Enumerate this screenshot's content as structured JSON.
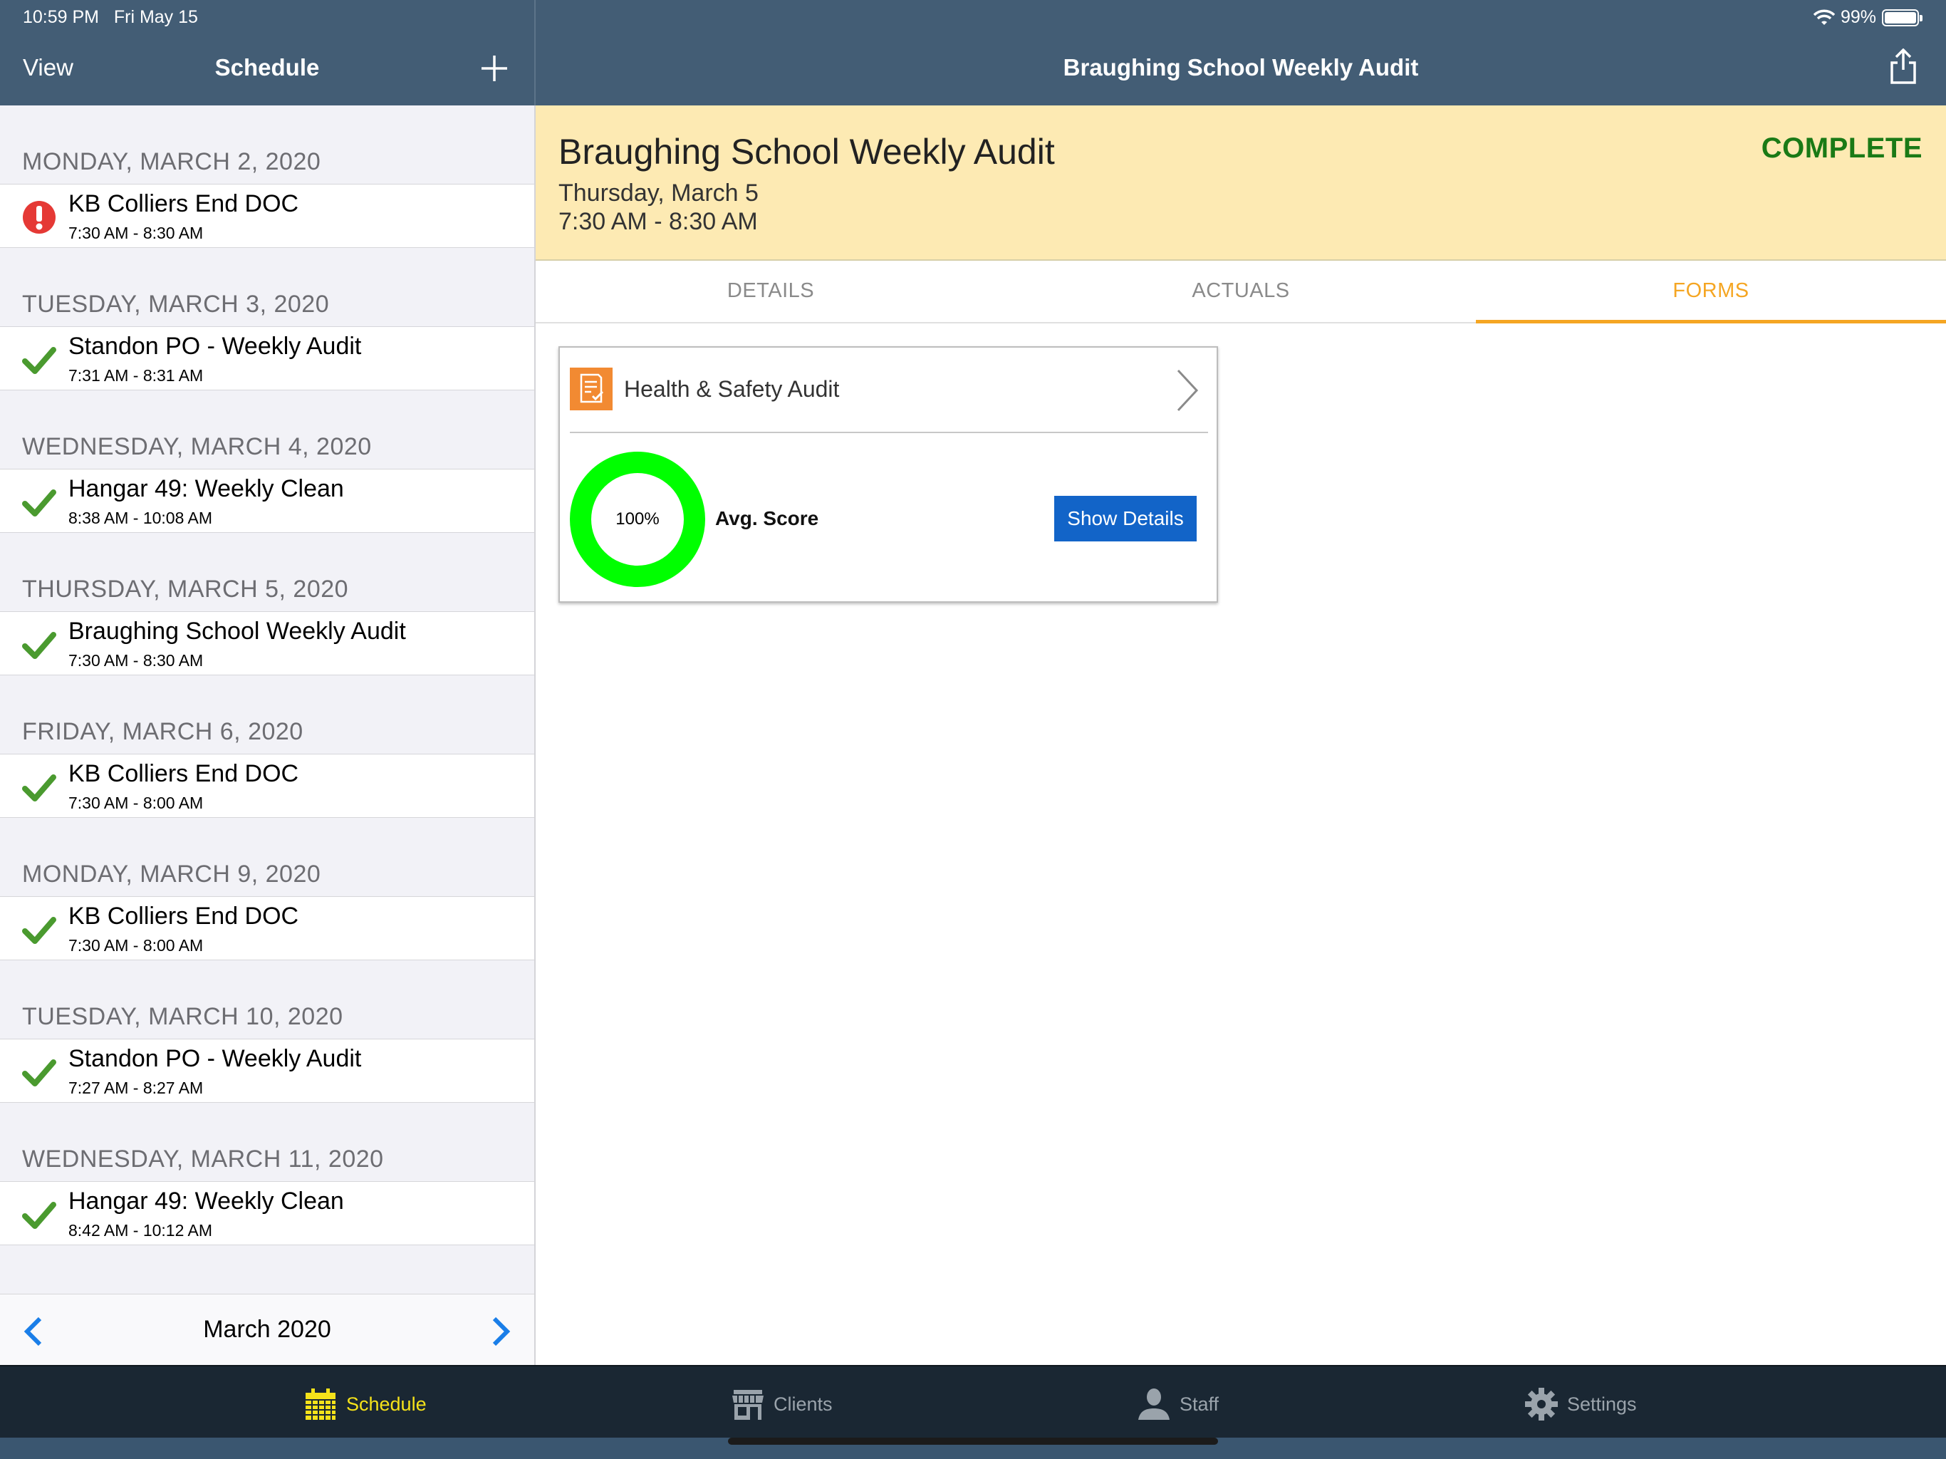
{
  "status_bar": {
    "time": "10:59 PM",
    "date": "Fri May 15",
    "battery": "99%",
    "battery_level": 0.99
  },
  "sidebar_nav": {
    "view_label": "View",
    "title": "Schedule"
  },
  "detail_nav": {
    "title": "Braughing School Weekly Audit"
  },
  "schedule": [
    {
      "day": "MONDAY, MARCH 2, 2020",
      "title": "KB Colliers End DOC",
      "time": "7:30 AM - 8:30 AM",
      "status": "alert"
    },
    {
      "day": "TUESDAY, MARCH 3, 2020",
      "title": "Standon PO - Weekly Audit",
      "time": "7:31 AM - 8:31 AM",
      "status": "done"
    },
    {
      "day": "WEDNESDAY, MARCH 4, 2020",
      "title": "Hangar 49: Weekly Clean",
      "time": "8:38 AM - 10:08 AM",
      "status": "done"
    },
    {
      "day": "THURSDAY, MARCH 5, 2020",
      "title": "Braughing School Weekly Audit",
      "time": "7:30 AM - 8:30 AM",
      "status": "done"
    },
    {
      "day": "FRIDAY, MARCH 6, 2020",
      "title": "KB Colliers End DOC",
      "time": "7:30 AM - 8:00 AM",
      "status": "done"
    },
    {
      "day": "MONDAY, MARCH 9, 2020",
      "title": "KB Colliers End DOC",
      "time": "7:30 AM - 8:00 AM",
      "status": "done"
    },
    {
      "day": "TUESDAY, MARCH 10, 2020",
      "title": "Standon PO - Weekly Audit",
      "time": "7:27 AM - 8:27 AM",
      "status": "done"
    },
    {
      "day": "WEDNESDAY, MARCH 11, 2020",
      "title": "Hangar 49: Weekly Clean",
      "time": "8:42 AM - 10:12 AM",
      "status": "done"
    }
  ],
  "sidebar_footer": {
    "month": "March 2020"
  },
  "banner": {
    "title": "Braughing School Weekly Audit",
    "date": "Thursday, March 5",
    "time": "7:30 AM - 8:30 AM",
    "status": "COMPLETE"
  },
  "tabs": [
    {
      "label": "DETAILS",
      "active": false
    },
    {
      "label": "ACTUALS",
      "active": false
    },
    {
      "label": "FORMS",
      "active": true
    }
  ],
  "form_card": {
    "title": "Health & Safety Audit",
    "score_label": "100%",
    "score": 1.0,
    "avg_label": "Avg. Score",
    "button_label": "Show Details"
  },
  "tabbar": [
    {
      "label": "Schedule",
      "icon": "calendar-icon",
      "active": true
    },
    {
      "label": "Clients",
      "icon": "store-icon",
      "active": false
    },
    {
      "label": "Staff",
      "icon": "person-icon",
      "active": false
    },
    {
      "label": "Settings",
      "icon": "gear-icon",
      "active": false
    }
  ],
  "colors": {
    "nav": "#435d75",
    "banner": "#fdeab3",
    "complete": "#1a7a16",
    "accent": "#f5a623",
    "check": "#4a9a2f",
    "alert": "#e53935",
    "score_ring": "#00ff00",
    "button": "#1264c8",
    "tabbar_active": "#f5e21a"
  }
}
